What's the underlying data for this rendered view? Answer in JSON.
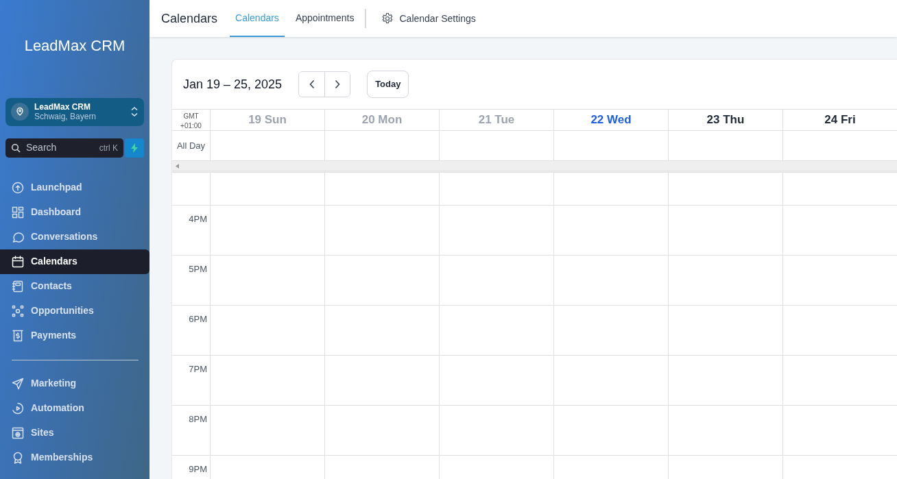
{
  "sidebar": {
    "brand": "LeadMax CRM",
    "location": {
      "name": "LeadMax CRM",
      "address": "Schwaig, Bayern"
    },
    "search": {
      "placeholder": "Search",
      "shortcut": "ctrl K"
    },
    "items": [
      {
        "label": "Launchpad",
        "selected": false
      },
      {
        "label": "Dashboard",
        "selected": false
      },
      {
        "label": "Conversations",
        "selected": false
      },
      {
        "label": "Calendars",
        "selected": true
      },
      {
        "label": "Contacts",
        "selected": false
      },
      {
        "label": "Opportunities",
        "selected": false
      },
      {
        "label": "Payments",
        "selected": false
      }
    ],
    "items_2": [
      {
        "label": "Marketing",
        "selected": false
      },
      {
        "label": "Automation",
        "selected": false
      },
      {
        "label": "Sites",
        "selected": false
      },
      {
        "label": "Memberships",
        "selected": false
      }
    ]
  },
  "header": {
    "title": "Calendars",
    "tabs": [
      {
        "label": "Calendars",
        "selected": true
      },
      {
        "label": "Appointments",
        "selected": false
      }
    ],
    "settings": "Calendar Settings"
  },
  "calendar": {
    "range": "Jan 19 – 25, 2025",
    "today_button": "Today",
    "timezone": [
      "GMT",
      "+01:00"
    ],
    "all_day": "All Day",
    "days": [
      {
        "label": "19 Sun",
        "kind": "past"
      },
      {
        "label": "20 Mon",
        "kind": "past"
      },
      {
        "label": "21 Tue",
        "kind": "past"
      },
      {
        "label": "22 Wed",
        "kind": "today"
      },
      {
        "label": "23 Thu",
        "kind": "future"
      },
      {
        "label": "24 Fri",
        "kind": "future"
      }
    ],
    "hours": [
      "4PM",
      "5PM",
      "6PM",
      "7PM",
      "8PM",
      "9PM"
    ]
  }
}
